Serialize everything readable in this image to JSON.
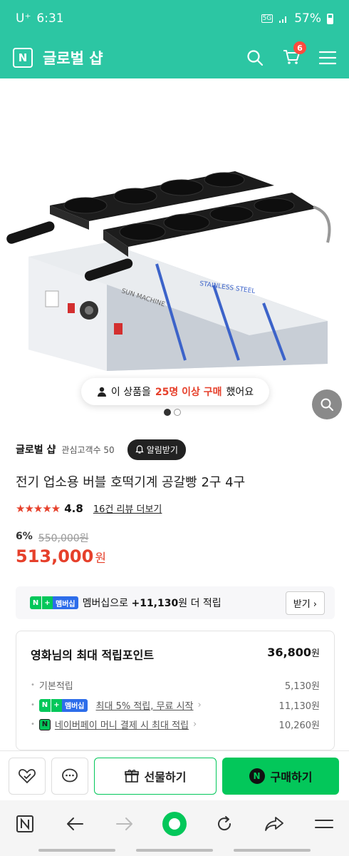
{
  "status": {
    "carrier": "U⁺",
    "time": "6:31",
    "network": "5G",
    "battery": "57%"
  },
  "header": {
    "logo_letter": "N",
    "title": "글로벌 샵",
    "cart_count": "6"
  },
  "product_image": {
    "buyers_prefix": "이 상품을",
    "buyers_highlight": "25명 이상 구매",
    "buyers_suffix": "했어요",
    "slide_count": 2,
    "active_slide": 1,
    "machine_text_1": "SUN MACHINE",
    "machine_text_2": "STAINLESS STEEL"
  },
  "seller": {
    "name": "글로벌 샵",
    "fans": "관심고객수 50",
    "alarm_label": "알림받기"
  },
  "product": {
    "name": "전기 업소용 버블 호떡기계 공갈빵 2구 4구",
    "stars": "★★★★★",
    "rating": "4.8",
    "review_link": "16건 리뷰 더보기",
    "discount": "6%",
    "original_price": "550,000원",
    "price": "513,000",
    "price_unit": "원"
  },
  "membership": {
    "badge_n": "N",
    "badge_plus": "+",
    "badge_text": "멤버십",
    "text_prefix": "멤버십으로",
    "text_amount": "+11,130",
    "text_suffix": "원 더 적립",
    "button": "받기"
  },
  "points": {
    "title": "영화님의 최대 적립포인트",
    "total": "36,800",
    "total_unit": "원",
    "rows": [
      {
        "label": "기본적립",
        "value": "5,130원"
      },
      {
        "label": "최대 5% 적립, 무료 시작",
        "value": "11,130원"
      },
      {
        "label": "네이버페이 머니 결제 시 최대 적립",
        "value": "10,260원"
      }
    ]
  },
  "actions": {
    "gift_label": "선물하기",
    "buy_label": "구매하기",
    "buy_logo": "N"
  },
  "colors": {
    "brand": "#2cc6a3",
    "naver_green": "#03c75a",
    "price_red": "#e6402b"
  }
}
